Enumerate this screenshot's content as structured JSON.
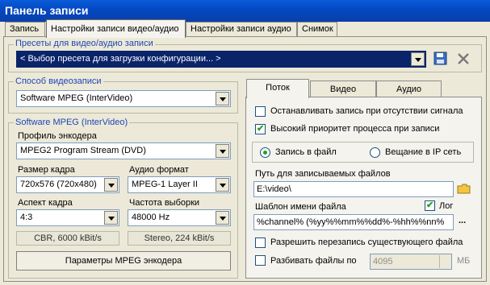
{
  "window": {
    "title": "Панель записи"
  },
  "tabs": [
    "Запись",
    "Настройки записи видео/аудио",
    "Настройки записи аудио",
    "Снимок"
  ],
  "presets": {
    "legend": "Пресеты для видео/аудио записи",
    "value": "< Выбор пресета для загрузки конфигурации... >"
  },
  "capture_method": {
    "legend": "Способ видеозаписи",
    "value": "Software MPEG (InterVideo)"
  },
  "software_mpeg": {
    "legend": "Software MPEG (InterVideo)",
    "encoder_profile_label": "Профиль энкодера",
    "encoder_profile_value": "MPEG2 Program Stream (DVD)",
    "frame_size_label": "Размер кадра",
    "frame_size_value": "720x576 (720x480)",
    "audio_format_label": "Аудио формат",
    "audio_format_value": "MPEG-1 Layer II",
    "aspect_label": "Аспект кадра",
    "aspect_value": "4:3",
    "sample_rate_label": "Частота выборки",
    "sample_rate_value": "48000 Hz",
    "video_bitrate_text": "CBR, 6000 kBit/s",
    "audio_bitrate_text": "Stereo, 224 kBit/s",
    "params_button": "Параметры MPEG энкодера"
  },
  "right_tabs": [
    "Поток",
    "Видео",
    "Аудио"
  ],
  "stream": {
    "stop_on_no_signal": "Останавливать запись при отсутствии сигнала",
    "high_priority": "Высокий приоритет процесса при записи",
    "record_to_file": "Запись в файл",
    "broadcast_ip": "Вещание в IP сеть",
    "path_label": "Путь для записываемых файлов",
    "path_value": "E:\\video\\",
    "filename_template_label": "Шаблон имени файла",
    "log_label": "Лог",
    "filename_template_value": "%channel% (%yy%%mm%%dd%-%hh%%nn%",
    "browse_dots": "...",
    "allow_overwrite": "Разрешить перезапись существующего файла",
    "split_files": "Разбивать файлы по",
    "split_value": "4095",
    "split_unit": "МБ"
  },
  "state": {
    "stop_on_no_signal": false,
    "high_priority": true,
    "record_to_file": true,
    "log": true,
    "allow_overwrite": false,
    "split_files": false
  },
  "icons": {
    "save": "save-preset-icon",
    "delete": "delete-preset-icon",
    "folder": "folder-icon"
  },
  "colors": {
    "title_bar": "#0a4fc9",
    "legend_text": "#1f46b4",
    "selected_combo": "#0a246a",
    "check_mark": "#21a121"
  }
}
